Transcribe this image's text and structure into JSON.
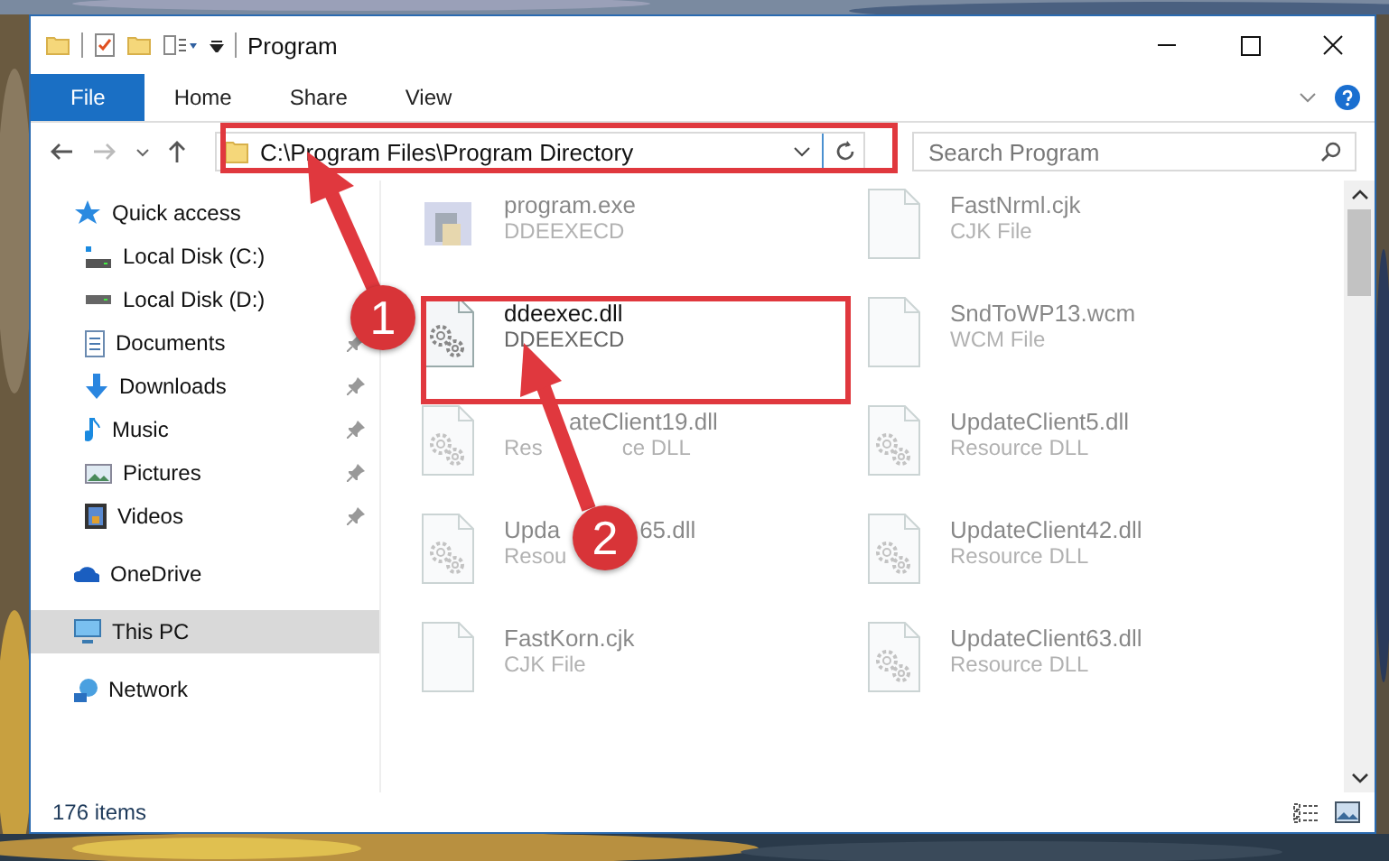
{
  "window": {
    "title": "Program"
  },
  "ribbon_tabs": [
    {
      "label": "File",
      "selected": true
    },
    {
      "label": "Home",
      "selected": false
    },
    {
      "label": "Share",
      "selected": false
    },
    {
      "label": "View",
      "selected": false
    }
  ],
  "address_bar": {
    "path": "C:\\Program Files\\Program Directory"
  },
  "search": {
    "placeholder": "Search Program"
  },
  "sidebar": {
    "items": [
      {
        "label": "Quick access",
        "kind": "star",
        "selected": false,
        "children": [
          {
            "label": "Local Disk (C:)",
            "kind": "sysdrive",
            "pinned": false,
            "selected": false
          },
          {
            "label": "Local Disk (D:)",
            "kind": "drive",
            "selected": false
          },
          {
            "label": "Documents",
            "kind": "documents",
            "pinned": true,
            "selected": false
          },
          {
            "label": "Downloads",
            "kind": "downloads",
            "pinned": true,
            "selected": false
          },
          {
            "label": "Music",
            "kind": "music",
            "pinned": true,
            "selected": false
          },
          {
            "label": "Pictures",
            "kind": "pictures",
            "pinned": true,
            "selected": false
          },
          {
            "label": "Videos",
            "kind": "videos",
            "pinned": true,
            "selected": false
          }
        ]
      },
      {
        "label": "OneDrive",
        "kind": "cloud",
        "selected": false
      },
      {
        "label": "This PC",
        "kind": "pc",
        "selected": true
      },
      {
        "label": "Network",
        "kind": "network",
        "selected": false
      }
    ]
  },
  "files": [
    {
      "name_pieces": [
        "program.exe"
      ],
      "type_pieces": [
        "DDEEXECD"
      ],
      "kind": "program",
      "blurred": true
    },
    {
      "name_pieces": [
        "FastNrml.cjk"
      ],
      "type_pieces": [
        "CJK File"
      ],
      "kind": "blank",
      "blurred": true
    },
    {
      "name_pieces": [
        "ddeexec.dll"
      ],
      "type_pieces": [
        "DDEEXECD"
      ],
      "kind": "gear",
      "blurred": false
    },
    {
      "name_pieces": [
        "SndToWP13.wcm"
      ],
      "type_pieces": [
        "WCM File"
      ],
      "kind": "blank",
      "blurred": true
    },
    {
      "name_pieces": [
        "ateClient19.dll"
      ],
      "type_pieces": [
        "Res",
        "ce DLL"
      ],
      "name_covered_start": true,
      "kind": "gear",
      "blurred": true
    },
    {
      "name_pieces": [
        "UpdateClient5.dll"
      ],
      "type_pieces": [
        "Resource DLL"
      ],
      "kind": "gear",
      "blurred": true
    },
    {
      "name_pieces": [
        "Upda",
        "65.dll"
      ],
      "type_pieces": [
        "Resou"
      ],
      "kind": "gear",
      "blurred": true
    },
    {
      "name_pieces": [
        "UpdateClient42.dll"
      ],
      "type_pieces": [
        "Resource DLL"
      ],
      "kind": "gear",
      "blurred": true
    },
    {
      "name_pieces": [
        "FastKorn.cjk"
      ],
      "type_pieces": [
        "CJK File"
      ],
      "kind": "blank",
      "blurred": true
    },
    {
      "name_pieces": [
        "UpdateClient63.dll"
      ],
      "type_pieces": [
        "Resource DLL"
      ],
      "kind": "gear",
      "blurred": true
    }
  ],
  "status_bar": {
    "item_count": "176 items"
  },
  "callouts": [
    {
      "number": "1"
    },
    {
      "number": "2"
    }
  ]
}
